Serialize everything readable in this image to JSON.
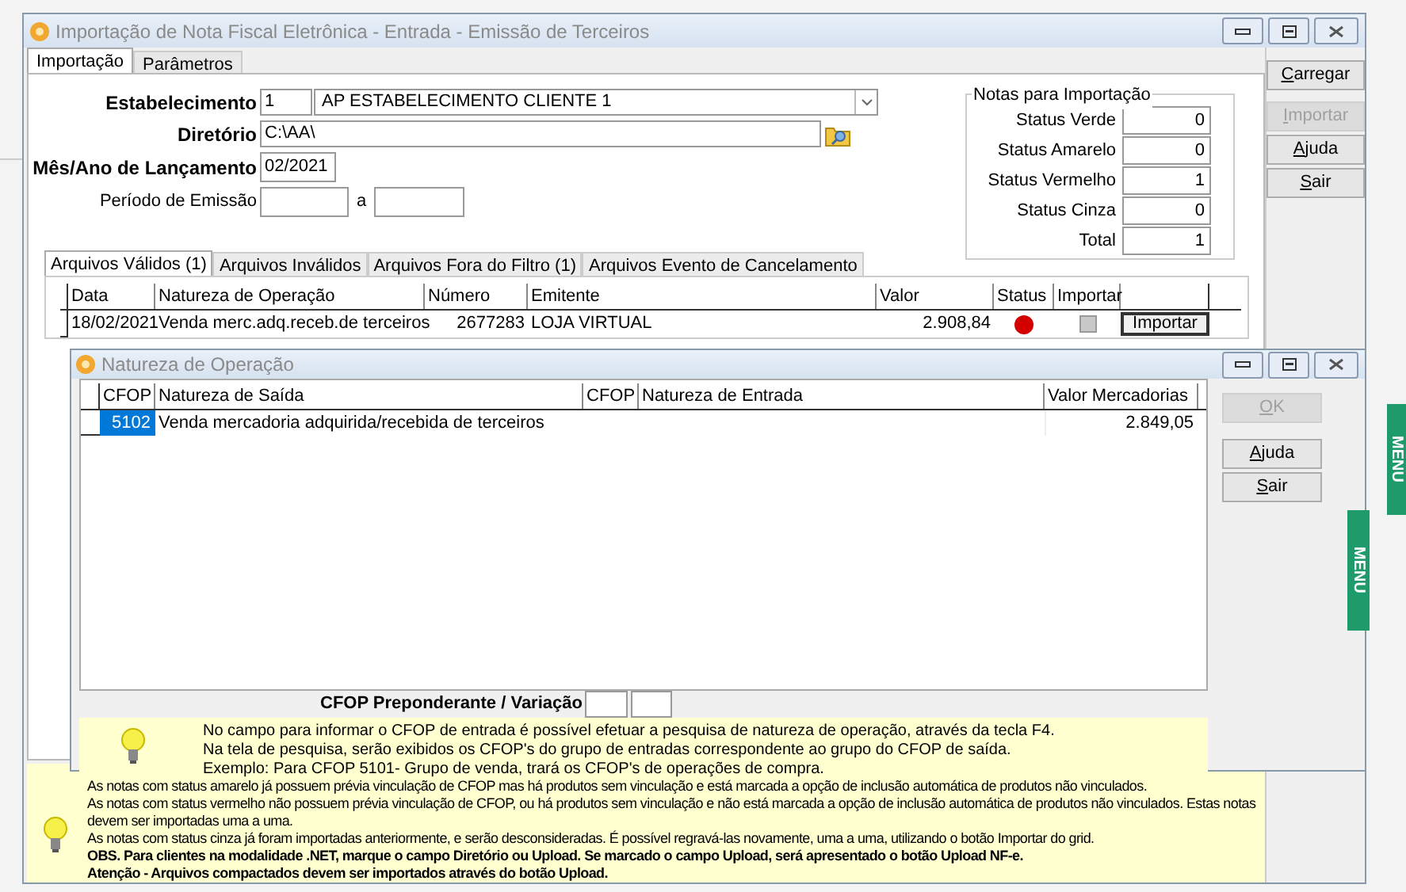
{
  "main_window": {
    "title": "Importação de Nota Fiscal Eletrônica - Entrada - Emissão de Terceiros",
    "tabs": [
      {
        "label": "Importação",
        "selected": true
      },
      {
        "label": "Parâmetros",
        "selected": false
      }
    ],
    "form": {
      "estabelecimento": {
        "label": "Estabelecimento",
        "code": "1",
        "name": "AP ESTABELECIMENTO CLIENTE 1"
      },
      "diretorio": {
        "label": "Diretório",
        "value": "C:\\AA\\"
      },
      "mes_ano": {
        "label": "Mês/Ano de Lançamento",
        "value": "02/2021"
      },
      "periodo": {
        "label": "Período de Emissão",
        "separator": "a"
      }
    },
    "notas_group": {
      "title": "Notas para Importação",
      "rows": [
        {
          "label": "Status Verde",
          "value": "0"
        },
        {
          "label": "Status Amarelo",
          "value": "0"
        },
        {
          "label": "Status Vermelho",
          "value": "1"
        },
        {
          "label": "Status Cinza",
          "value": "0"
        },
        {
          "label": "Total",
          "value": "1"
        }
      ]
    },
    "file_tabs": [
      {
        "label": "Arquivos Válidos (1)",
        "selected": true
      },
      {
        "label": "Arquivos Inválidos",
        "selected": false
      },
      {
        "label": "Arquivos Fora do Filtro (1)",
        "selected": false
      },
      {
        "label": "Arquivos Evento de Cancelamento",
        "selected": false
      }
    ],
    "grid": {
      "columns": [
        "Data",
        "Natureza de Operação",
        "Número",
        "Emitente",
        "Valor",
        "Status",
        "Importar"
      ],
      "rows": [
        {
          "data": "18/02/2021",
          "natureza": "Venda merc.adq.receb.de terceiros",
          "numero": "2677283",
          "emitente": "LOJA VIRTUAL",
          "valor": "2.908,84",
          "color": "#d40000",
          "checked": false,
          "button": "Importar"
        }
      ]
    },
    "buttons": [
      {
        "accel": "C",
        "rest": "arregar",
        "disabled": false
      },
      {
        "accel": "I",
        "rest": "mportar",
        "disabled": true
      },
      {
        "accel": "A",
        "rest": "juda",
        "disabled": false
      },
      {
        "accel": "S",
        "rest": "air",
        "disabled": false
      }
    ],
    "notes": [
      {
        "text": "As notas com status amarelo já possuem prévia vinculação de CFOP mas há produtos sem vinculação e está marcada a opção de inclusão automática de produtos não vinculados.",
        "emphasis": false
      },
      {
        "text": "As notas com status vermelho não possuem prévia vinculação de CFOP, ou há produtos sem vinculação e não está marcada a opção de inclusão automática de produtos não vinculados. Estas notas devem ser importadas uma a uma.",
        "emphasis": false
      },
      {
        "text": "As notas com status cinza já foram importadas anteriormente, e serão desconsideradas. É possível regravá-las novamente, uma a uma, utilizando o botão Importar do grid.",
        "emphasis": false
      },
      {
        "text": "OBS. Para clientes na modalidade .NET, marque o campo Diretório ou Upload. Se marcado o campo Upload, será apresentado o botão Upload NF-e.",
        "emphasis": true
      },
      {
        "text": "Atenção - Arquivos compactados devem ser importados através do botão Upload.",
        "emphasis": true
      }
    ]
  },
  "dialog": {
    "title": "Natureza de Operação",
    "grid": {
      "columns": [
        "CFOP",
        "Natureza de Saída",
        "CFOP",
        "Natureza de Entrada",
        "Valor Mercadorias"
      ],
      "rows": [
        {
          "cfop_saida": "5102",
          "natureza_saida": "Venda mercadoria adquirida/recebida de terceiros",
          "valor": "2.849,05",
          "selected": true
        }
      ]
    },
    "preponderante_label": "CFOP Preponderante / Variação",
    "tips": [
      "No campo para informar o CFOP de entrada é possível efetuar a pesquisa de natureza de operação, através da tecla F4.",
      "Na tela de pesquisa, serão exibidos os CFOP's do grupo de entradas correspondente ao grupo do CFOP de saída.",
      "Exemplo: Para CFOP 5101- Grupo de venda, trará os CFOP's de operações de compra."
    ],
    "buttons": [
      {
        "accel": "O",
        "rest": "K",
        "disabled": true
      },
      {
        "accel": "A",
        "rest": "juda",
        "disabled": false
      },
      {
        "accel": "S",
        "rest": "air",
        "disabled": false
      }
    ],
    "menu_tab": "MENU"
  },
  "side_menu_tab": "MENU"
}
